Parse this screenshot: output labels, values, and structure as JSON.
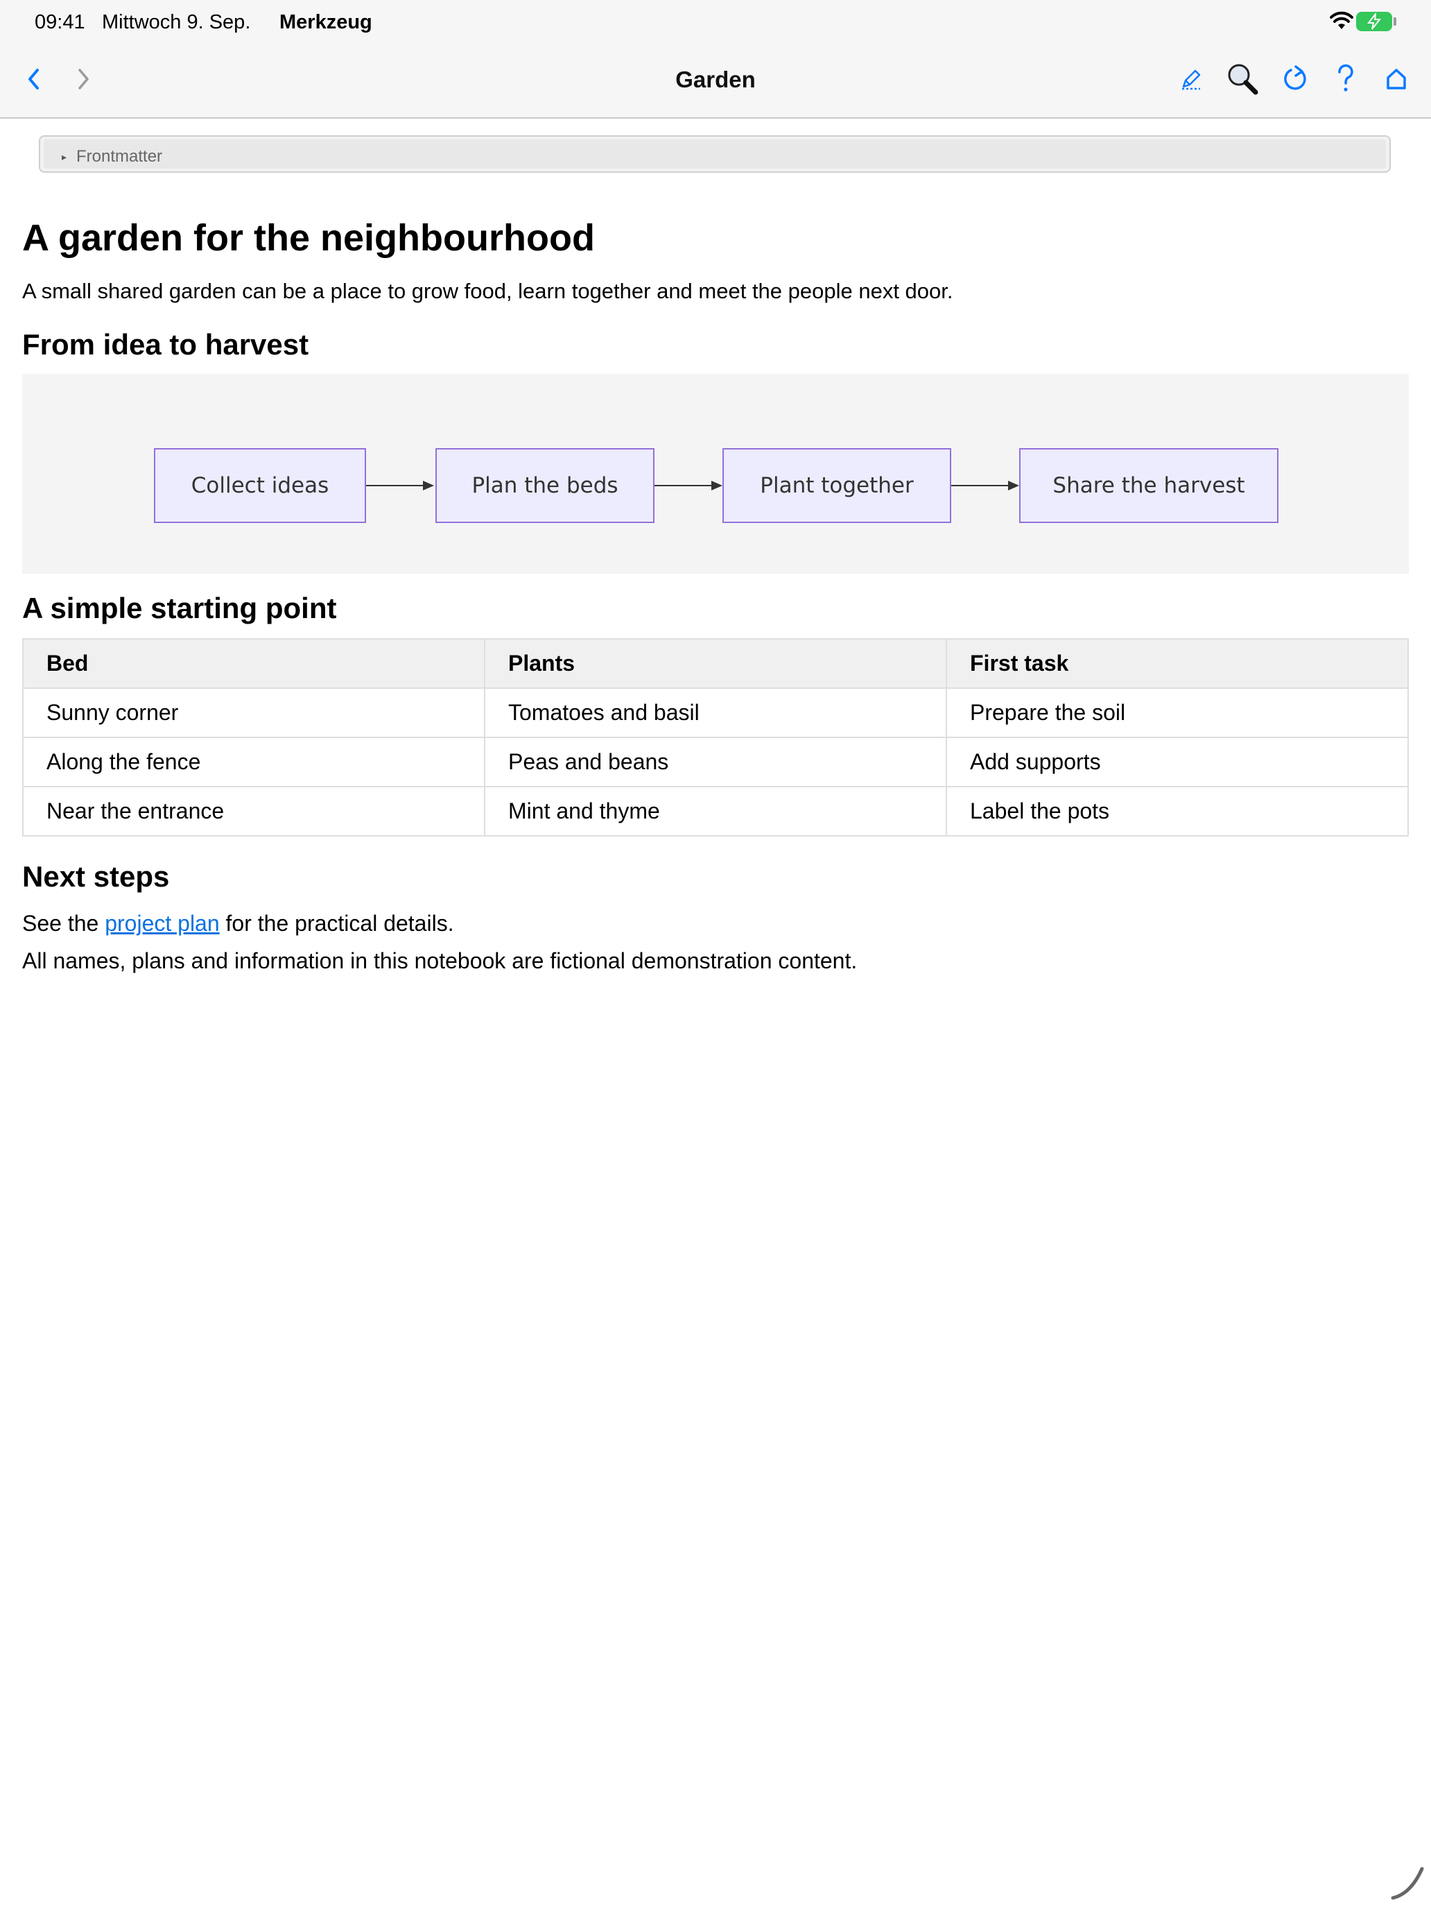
{
  "status_bar": {
    "time": "09:41",
    "date": "Mittwoch 9. Sep.",
    "app": "Merkzeug",
    "battery_color": "#34c759"
  },
  "nav": {
    "title": "Garden",
    "accent": "#0a7aff",
    "icons": [
      "back-chevron-icon",
      "forward-chevron-icon",
      "pencil-icon",
      "magnifier-icon",
      "reload-icon",
      "help-icon",
      "home-icon"
    ]
  },
  "frontmatter": {
    "label": "Frontmatter"
  },
  "content": {
    "title": "A garden for the neighbourhood",
    "intro": "A small shared garden can be a place to grow food, learn together and meet the people next door.",
    "section1": "From idea to harvest",
    "section2": "A simple starting point",
    "section3": "Next steps",
    "next_prefix": "See the ",
    "next_link": "project plan",
    "next_suffix": " for the practical details.",
    "disclaimer": "All names, plans and information in this notebook are fictional demonstration content."
  },
  "diagram": {
    "steps": [
      "Collect ideas",
      "Plan the beds",
      "Plant together",
      "Share the harvest"
    ],
    "node_fill": "#ececfe",
    "node_stroke": "#9370db"
  },
  "table": {
    "headers": [
      "Bed",
      "Plants",
      "First task"
    ],
    "rows": [
      [
        "Sunny corner",
        "Tomatoes and basil",
        "Prepare the soil"
      ],
      [
        "Along the fence",
        "Peas and beans",
        "Add supports"
      ],
      [
        "Near the entrance",
        "Mint and thyme",
        "Label the pots"
      ]
    ]
  }
}
